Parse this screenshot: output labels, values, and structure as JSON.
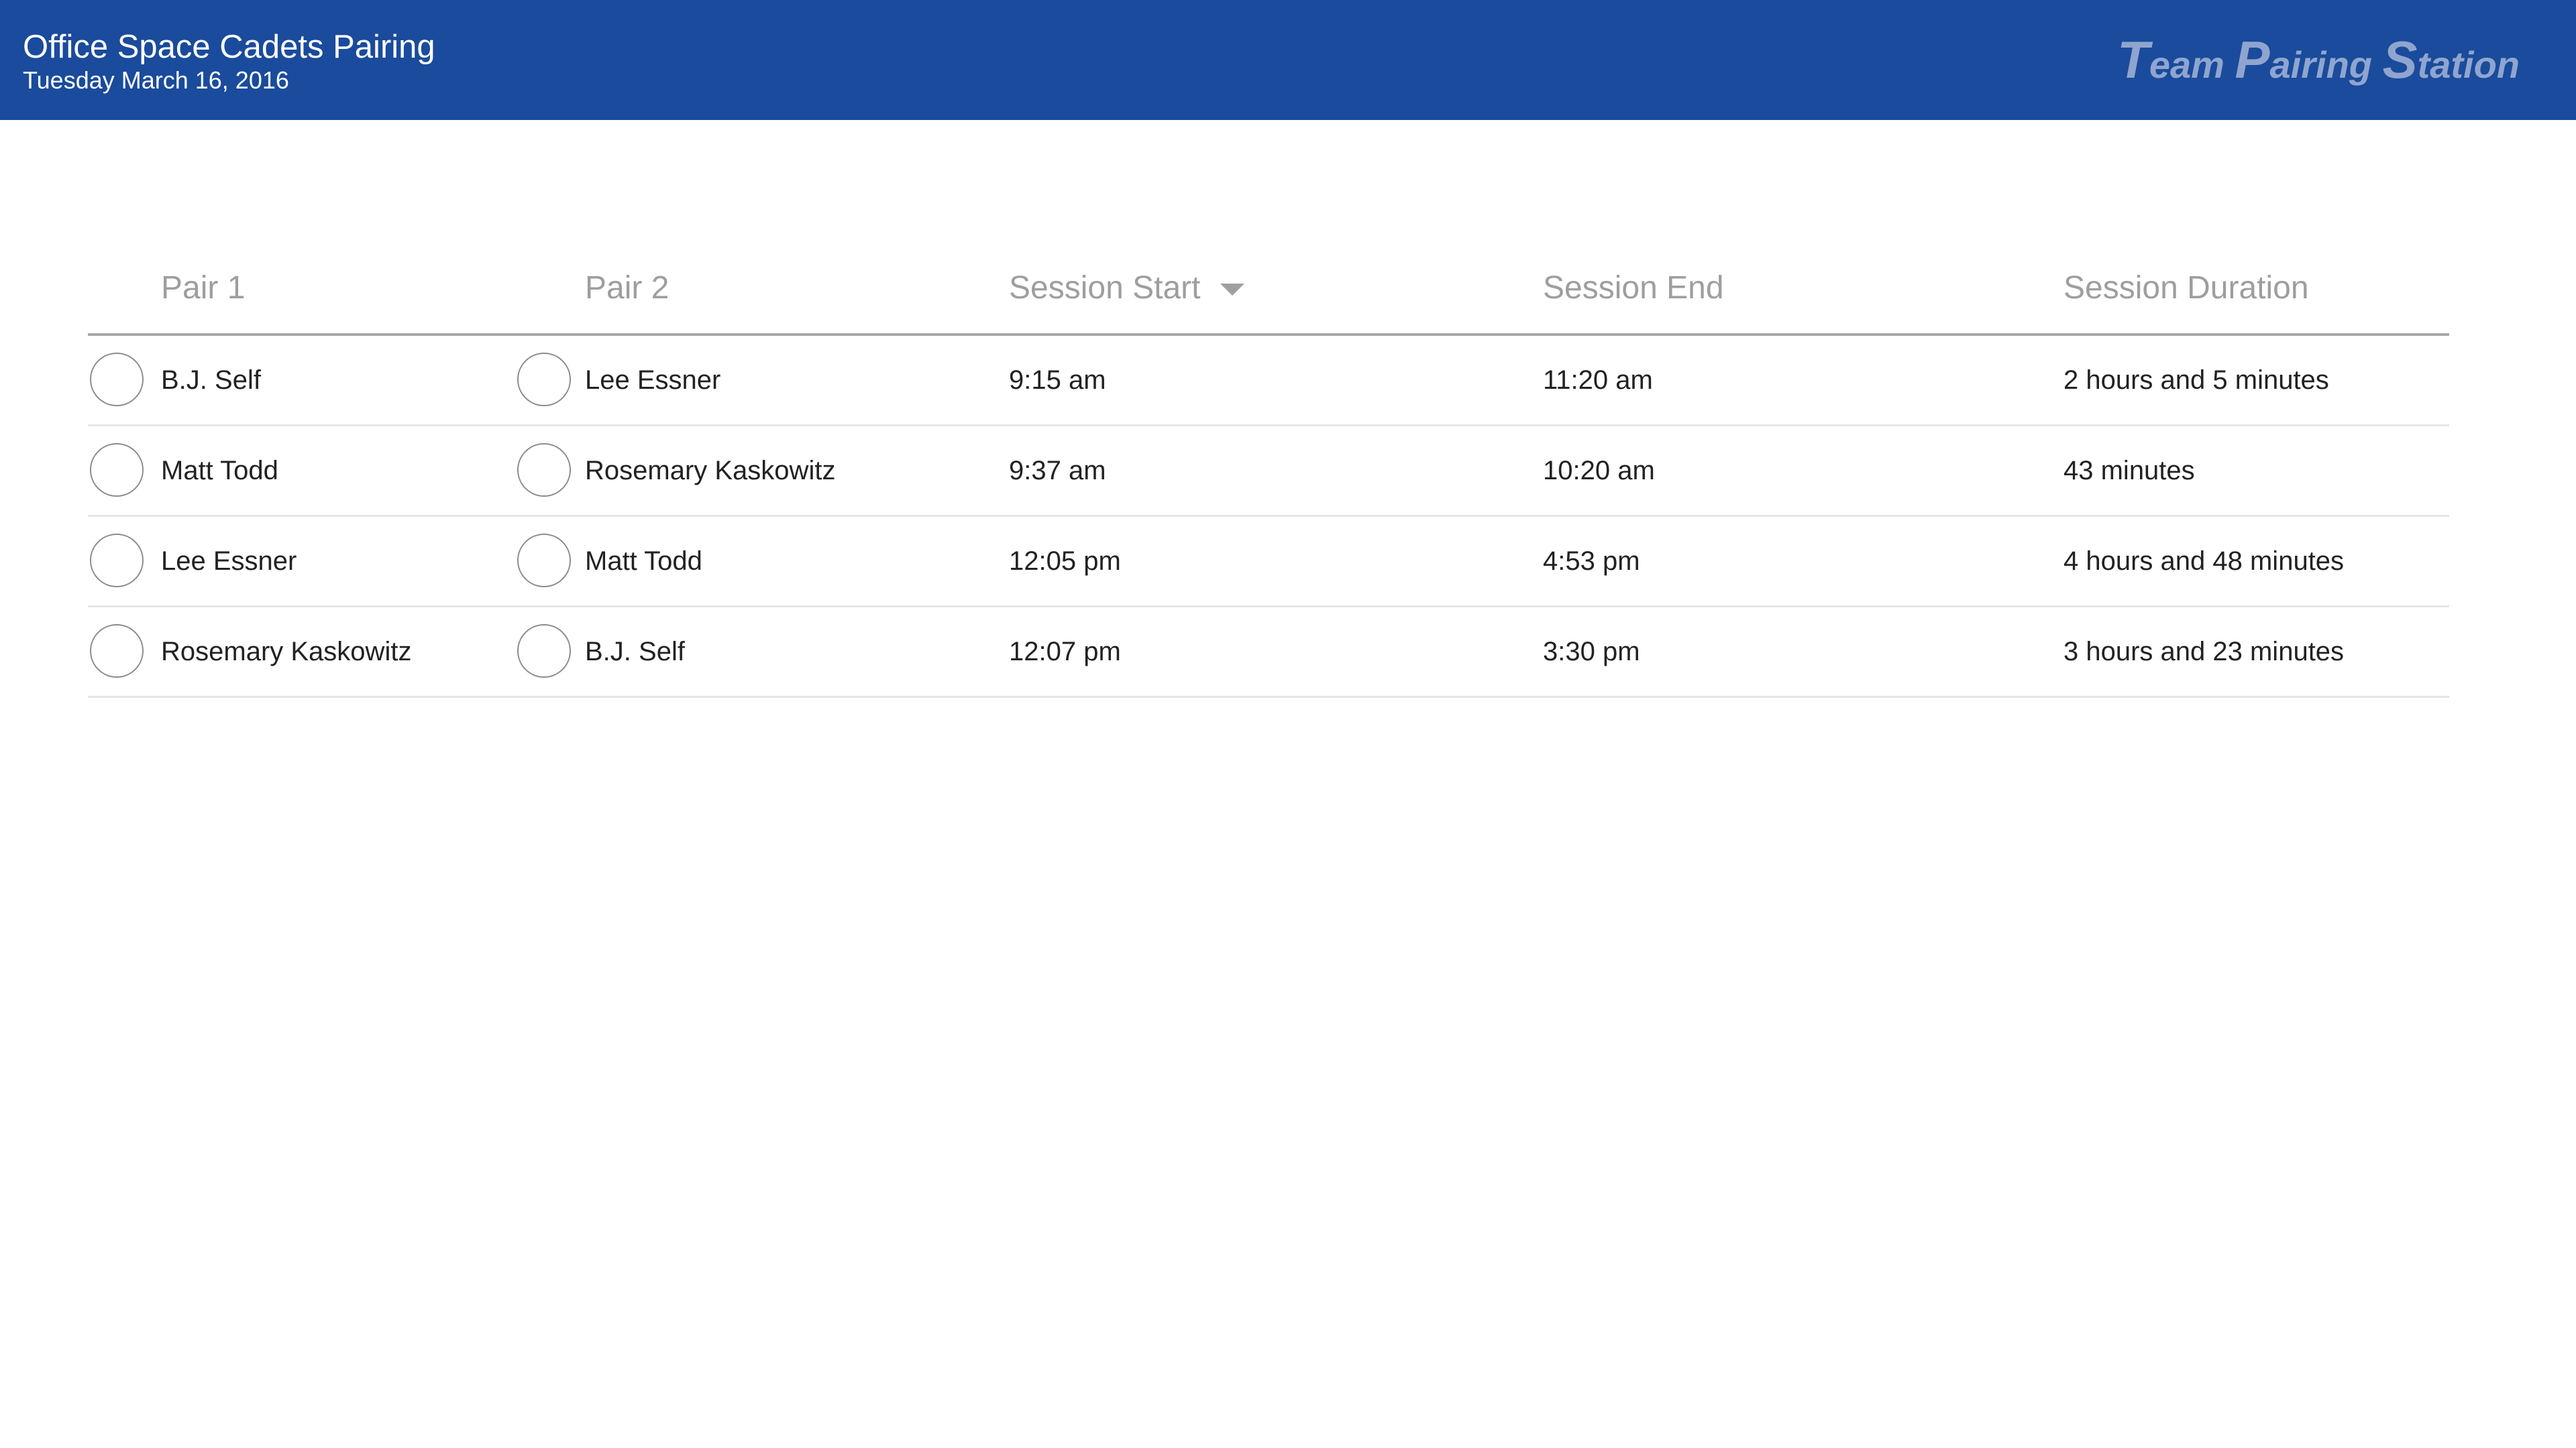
{
  "header": {
    "title": "Office Space Cadets Pairing",
    "date": "Tuesday March 16, 2016",
    "brand": {
      "word1_cap": "T",
      "word1_rest": "eam",
      "word2_cap": "P",
      "word2_rest": "airing",
      "word3_cap": "S",
      "word3_rest": "tation"
    }
  },
  "table": {
    "columns": {
      "pair1": "Pair 1",
      "pair2": "Pair 2",
      "session_start": "Session Start",
      "session_end": "Session End",
      "session_duration": "Session Duration"
    },
    "sort": {
      "column": "session_start",
      "direction": "descending",
      "icon": "caret-down-icon"
    },
    "rows": [
      {
        "pair1": "B.J. Self",
        "pair2": "Lee Essner",
        "start": "9:15 am",
        "end": "11:20 am",
        "duration": "2 hours and 5 minutes"
      },
      {
        "pair1": "Matt Todd",
        "pair2": "Rosemary Kaskowitz",
        "start": "9:37 am",
        "end": "10:20 am",
        "duration": "43 minutes"
      },
      {
        "pair1": "Lee Essner",
        "pair2": "Matt Todd",
        "start": "12:05 pm",
        "end": "4:53 pm",
        "duration": "4 hours and 48 minutes"
      },
      {
        "pair1": "Rosemary Kaskowitz",
        "pair2": "B.J. Self",
        "start": "12:07 pm",
        "end": "3:30 pm",
        "duration": "3 hours and 23 minutes"
      }
    ]
  },
  "colors": {
    "header_bg": "#1a4b9c",
    "brand_text": "#8fa5cf",
    "header_text": "#ffffff",
    "column_header_text": "#9e9e9e"
  }
}
